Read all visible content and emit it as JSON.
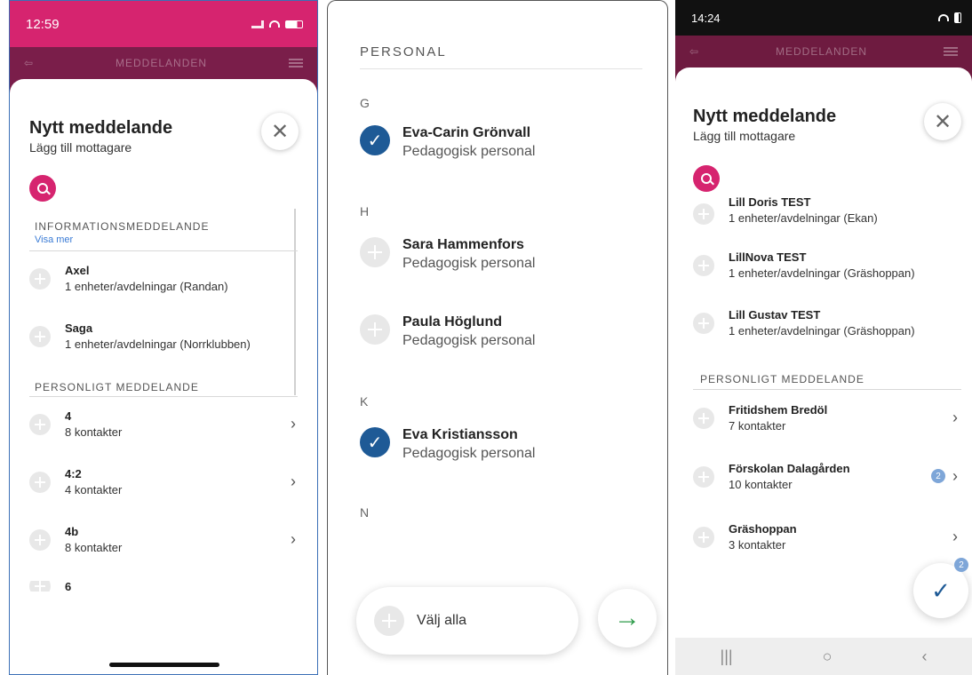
{
  "panel1": {
    "status": {
      "time": "12:59"
    },
    "appbar_title": "MEDDELANDEN",
    "sheet": {
      "title": "Nytt meddelande",
      "subtitle": "Lägg till mottagare"
    },
    "info_section": {
      "header": "INFORMATIONSMEDDELANDE",
      "show_more": "Visa mer",
      "items": [
        {
          "name": "Axel",
          "sub": "1 enheter/avdelningar (Randan)"
        },
        {
          "name": "Saga",
          "sub": "1 enheter/avdelningar (Norrklubben)"
        }
      ]
    },
    "personal_section": {
      "header": "PERSONLIGT MEDDELANDE",
      "items": [
        {
          "name": "4",
          "sub": "8 kontakter"
        },
        {
          "name": "4:2",
          "sub": "4 kontakter"
        },
        {
          "name": "4b",
          "sub": "8 kontakter"
        },
        {
          "name": "6",
          "sub": ""
        }
      ]
    }
  },
  "panel2": {
    "header": "PERSONAL",
    "groups": [
      {
        "letter": "G"
      },
      {
        "letter": "H"
      },
      {
        "letter": "K"
      },
      {
        "letter": "N"
      }
    ],
    "people": [
      {
        "name": "Eva-Carin Grönvall",
        "role": "Pedagogisk personal",
        "selected": true
      },
      {
        "name": "Sara Hammenfors",
        "role": "Pedagogisk personal",
        "selected": false
      },
      {
        "name": "Paula Höglund",
        "role": "Pedagogisk personal",
        "selected": false
      },
      {
        "name": "Eva Kristiansson",
        "role": "Pedagogisk personal",
        "selected": true
      }
    ],
    "select_all": "Välj alla",
    "next_icon": "arrow-right-icon"
  },
  "panel3": {
    "status": {
      "time": "14:24"
    },
    "appbar_title": "MEDDELANDEN",
    "sheet": {
      "title": "Nytt meddelande",
      "subtitle": "Lägg till mottagare"
    },
    "partial_item": {
      "name": "Lill Doris TEST",
      "sub": "1 enheter/avdelningar (Ekan)"
    },
    "items": [
      {
        "name": "LillNova TEST",
        "sub": "1 enheter/avdelningar (Gräshoppan)"
      },
      {
        "name": "Lill Gustav TEST",
        "sub": "1 enheter/avdelningar (Gräshoppan)"
      }
    ],
    "personal_section": {
      "header": "PERSONLIGT MEDDELANDE",
      "items": [
        {
          "name": "Fritidshem Bredöl",
          "sub": "7 kontakter",
          "badge": ""
        },
        {
          "name": "Förskolan Dalagården",
          "sub": "10 kontakter",
          "badge": "2"
        },
        {
          "name": "Gräshoppan",
          "sub": "3 kontakter",
          "badge": ""
        }
      ]
    },
    "fab_badge": "2"
  },
  "colors": {
    "accent": "#d6246f",
    "selected": "#1e5a96",
    "next": "#2e9b4a"
  }
}
